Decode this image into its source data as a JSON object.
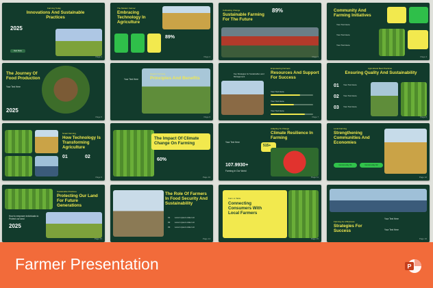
{
  "footer": {
    "title": "Farmer Presentation",
    "icon": "powerpoint-icon",
    "bg": "#f26b3a"
  },
  "colors": {
    "slide_bg": "#123b2c",
    "accent_yellow": "#f2e94e",
    "accent_green": "#31c24b"
  },
  "slides": {
    "s1": {
      "tag": "Farming Today",
      "title": "Innovations And Sustainable Practices",
      "year": "2025",
      "btn": "Get Now",
      "page": "Page 1"
    },
    "s2": {
      "tag": "The Modern Farmer",
      "title": "Embracing Technology In Agriculture",
      "stat": "89%",
      "page": "Page 2"
    },
    "s3": {
      "tag": "Cultivating Change",
      "title": "Sustainable Farming For The Future",
      "stat": "89%",
      "page": "Page 3"
    },
    "s4": {
      "title": "Community And Farming Initiatives",
      "items": [
        "Your Text Here",
        "Your Text Here",
        "Your Text Here"
      ],
      "page": "Page 4"
    },
    "s5": {
      "title": "The Journey Of Food Production",
      "label": "Your Text Here",
      "year": "2025",
      "page": "Page 5"
    },
    "s6": {
      "tag": "Organic Farming",
      "title": "Principles And Benefits",
      "label": "Your Text Here",
      "page": "Page 6"
    },
    "s7": {
      "tag": "Empowering Farmers",
      "title": "Resources And Support For Success",
      "left_tag": "Key Strategies for Sustainable Land Management",
      "items": [
        "Your Text Here",
        "Your Text Here",
        "Your Text Here"
      ],
      "page": "Page 7"
    },
    "s8": {
      "tag": "Agricultural Best Practices",
      "title": "Ensuring Quality And Sustainability",
      "nums": [
        "01",
        "02",
        "03"
      ],
      "items": [
        "Your Text Here",
        "Your Text Here",
        "Your Text Here"
      ],
      "page": "Page 8"
    },
    "s9": {
      "tag": "Smart Farming",
      "title": "How Technology Is Transforming Agriculture",
      "nums": [
        "01",
        "02"
      ],
      "page": "Page 9"
    },
    "s10": {
      "title": "The Impact Of Climate Change On Farming",
      "stat": "60%",
      "page": "Page 10"
    },
    "s11": {
      "tag": "Adapting To Change",
      "title": "Climate Resilience In Farming",
      "badge": "515+",
      "label": "Your Text Here",
      "number": "107.9930+",
      "number_label": "Farming In Our World",
      "page": "Page 11"
    },
    "s12": {
      "tag": "Local Farming",
      "title": "Strengthening Communities And Economies",
      "pills": [
        "Community 01",
        "Community 02"
      ],
      "page": "Page 12"
    },
    "s13": {
      "tag": "Sustainable Practices",
      "title": "Protecting Our Land For Future Generations",
      "year": "2025",
      "text": "How to empower individuals to Protect our land",
      "page": "Page 13"
    },
    "s14": {
      "title": "The Role Of Farmers In Food Security And Sustainability",
      "nums": [
        "01",
        "02",
        "03"
      ],
      "items": [
        "Lorem ipsum dolor sit",
        "Lorem ipsum dolor sit",
        "Lorem ipsum dolor sit"
      ],
      "page": "Page 14"
    },
    "s15": {
      "tag": "Farm to Table",
      "title": "Connecting Consumers With Local Farmers",
      "page": "Page 15"
    },
    "s16": {
      "tag": "Farming As A Business",
      "title": "Strategies For Success",
      "labels": [
        "Your Text Here",
        "Your Text Here"
      ],
      "page": "Page 16"
    }
  }
}
